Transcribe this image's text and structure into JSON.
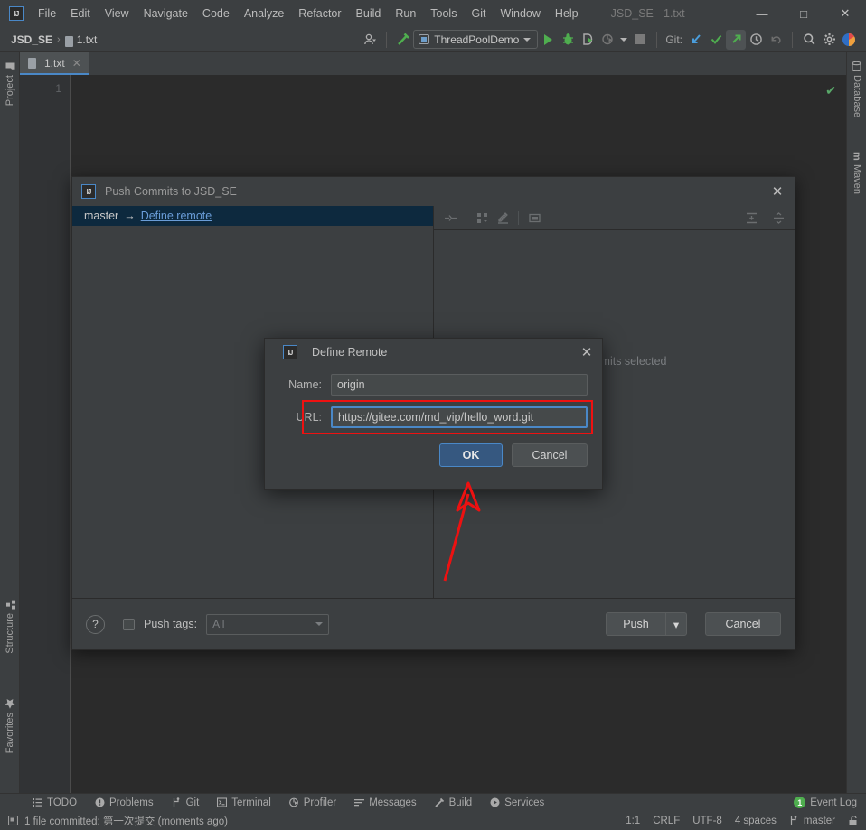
{
  "window": {
    "title": "JSD_SE - 1.txt",
    "logo_text": "IJ",
    "minimize": "—",
    "maximize": "□",
    "close": "✕"
  },
  "menu": [
    {
      "label": "File"
    },
    {
      "label": "Edit"
    },
    {
      "label": "View"
    },
    {
      "label": "Navigate"
    },
    {
      "label": "Code"
    },
    {
      "label": "Analyze"
    },
    {
      "label": "Refactor"
    },
    {
      "label": "Build"
    },
    {
      "label": "Run"
    },
    {
      "label": "Tools"
    },
    {
      "label": "Git"
    },
    {
      "label": "Window"
    },
    {
      "label": "Help"
    }
  ],
  "navbar": {
    "project": "JSD_SE",
    "separator": "›",
    "file": "1.txt",
    "run_config": "ThreadPoolDemo",
    "git_label": "Git:",
    "icons": {
      "profile": "user-profile-icon",
      "build_hammer": "build-hammer-icon",
      "run": "run-icon",
      "debug": "debug-icon",
      "run_coverage": "run-with-coverage-icon",
      "profile_run": "profile-icon",
      "stop": "stop-icon",
      "update": "git-update-icon",
      "commit": "git-commit-icon",
      "push": "git-push-icon",
      "history": "history-icon",
      "rollback": "rollback-icon",
      "search": "search-everywhere-icon",
      "settings": "settings-gear-icon",
      "account": "account-icon"
    }
  },
  "left_strip": {
    "project": "Project",
    "structure": "Structure",
    "favorites": "Favorites"
  },
  "right_strip": {
    "database": "Database",
    "maven": "Maven"
  },
  "editor": {
    "tab_label": "1.txt",
    "tab_close": "✕",
    "line_number": "1",
    "inspection_status": "✔"
  },
  "push_dialog": {
    "title": "Push Commits to JSD_SE",
    "close": "✕",
    "branch_source": "master",
    "branch_arrow": "→",
    "define_remote_link": "Define remote",
    "no_commits_text": "No commits selected",
    "toolbar_icons": [
      "show-diff-icon",
      "group-by-icon",
      "edit-icon",
      "preview-icon",
      "expand-all-icon",
      "collapse-all-icon"
    ],
    "help_label": "?",
    "push_tags_label": "Push tags:",
    "push_tags_value": "All",
    "push_button": "Push",
    "push_dropdown_arrow": "▾",
    "cancel_button": "Cancel"
  },
  "define_remote_dialog": {
    "title": "Define Remote",
    "close": "✕",
    "name_label": "Name:",
    "name_value": "origin",
    "url_label": "URL:",
    "url_value": "https://gitee.com/md_vip/hello_word.git",
    "ok_button": "OK",
    "cancel_button": "Cancel"
  },
  "annotations": {
    "highlight_color": "#ee1111",
    "arrow_target": "ok-button"
  },
  "bottom_tool_windows": [
    {
      "label": "TODO",
      "icon": "todo-icon"
    },
    {
      "label": "Problems",
      "icon": "problems-icon"
    },
    {
      "label": "Git",
      "icon": "git-branch-icon"
    },
    {
      "label": "Terminal",
      "icon": "terminal-icon"
    },
    {
      "label": "Profiler",
      "icon": "profiler-icon"
    },
    {
      "label": "Messages",
      "icon": "messages-icon"
    },
    {
      "label": "Build",
      "icon": "build-icon"
    },
    {
      "label": "Services",
      "icon": "services-icon"
    }
  ],
  "event_log": {
    "count": "1",
    "label": "Event Log"
  },
  "status_bar": {
    "message": "1 file committed: 第一次提交 (moments ago)",
    "caret": "1:1",
    "line_separator": "CRLF",
    "encoding": "UTF-8",
    "indent": "4 spaces",
    "branch": "master",
    "lock_icon": "unlocked-icon"
  }
}
